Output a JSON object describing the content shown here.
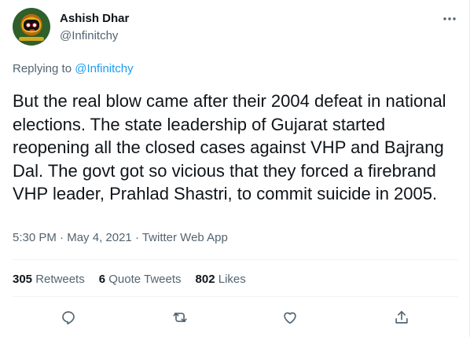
{
  "author": {
    "name": "Ashish Dhar",
    "handle": "@Infinitchy"
  },
  "reply": {
    "prefix": "Replying to ",
    "to": "@Infinitchy"
  },
  "tweet": {
    "text": "But the real blow came after their 2004 defeat in national elections. The state leadership of Gujarat started reopening all the closed cases against VHP and Bajrang Dal. The govt got so vicious that they forced a firebrand VHP leader, Prahlad Shastri, to commit suicide in 2005."
  },
  "meta": {
    "time": "5:30 PM",
    "sep1": " · ",
    "date": "May 4, 2021",
    "sep2": " · ",
    "source": "Twitter Web App"
  },
  "stats": {
    "retweets_count": "305",
    "retweets_label": " Retweets",
    "quotes_count": "6",
    "quotes_label": " Quote Tweets",
    "likes_count": "802",
    "likes_label": " Likes"
  },
  "icons": {
    "more": "more-dots-icon",
    "reply": "reply-icon",
    "retweet": "retweet-icon",
    "like": "like-icon",
    "share": "share-icon"
  },
  "colors": {
    "link": "#1d9bf0",
    "secondary": "#536471",
    "primary": "#0f1419",
    "divider": "#eff3f4"
  }
}
